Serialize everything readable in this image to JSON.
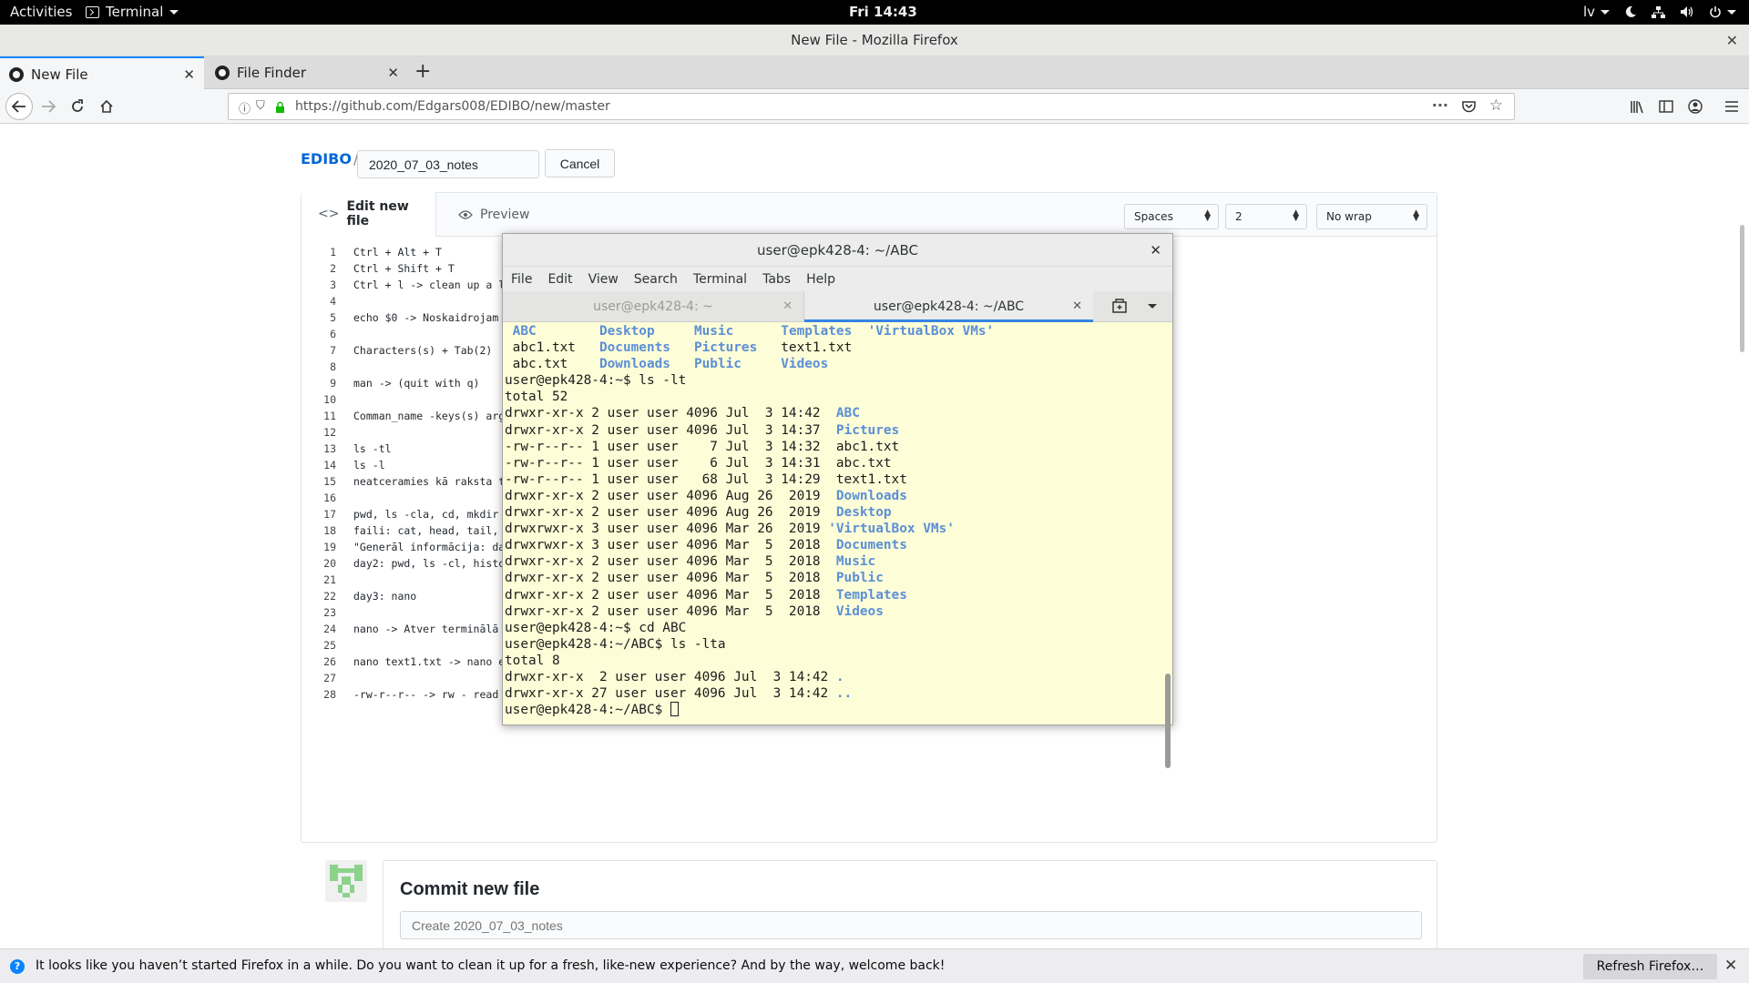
{
  "topbar": {
    "activities": "Activities",
    "app_name": "Terminal",
    "clock": "Fri 14:43",
    "language": "lv"
  },
  "firefox": {
    "window_title": "New File - Mozilla Firefox",
    "tabs": [
      {
        "label": "New File",
        "active": true
      },
      {
        "label": "File Finder",
        "active": false
      }
    ],
    "url_host": "https://github.com",
    "url_path": "/Edgars008/EDIBO/new/master",
    "notification": "It looks like you haven’t started Firefox in a while. Do you want to clean it up for a fresh, like-new experience? And by the way, welcome back!",
    "refresh_label": "Refresh Firefox…"
  },
  "github": {
    "repo": "EDIBO",
    "filename": "2020_07_03_notes",
    "cancel_label": "Cancel",
    "tab_edit": "Edit new file",
    "tab_preview": "Preview",
    "indent_mode": "Spaces",
    "indent_size": "2",
    "wrap_mode": "No wrap",
    "code_lines": [
      "Ctrl + Alt + T",
      "Ctrl + Shift + T",
      "Ctrl + l -> clean up a l",
      "",
      "echo $0 -> Noskaidrojam",
      "",
      "Characters(s) + Tab(2)",
      "",
      "man -> (quit with q)",
      "",
      "Comman_name -keys(s) arg",
      "",
      "ls -tl",
      "ls -l",
      "neatceramies kā raksta t",
      "",
      "pwd, ls -cla, cd, mkdir",
      "faili: cat, head, tail,",
      "\"Generāl informācija: da",
      "day2: pwd, ls -cl, histo",
      "",
      "day3: nano",
      "",
      "nano -> Atver terminālā",
      "",
      "nano text1.txt -> nano e",
      "",
      "-rw-r--r-- -> rw - read"
    ],
    "commit_title": "Commit new file",
    "commit_placeholder": "Create 2020_07_03_notes"
  },
  "terminal": {
    "title": "user@epk428-4: ~/ABC",
    "menu": [
      "File",
      "Edit",
      "View",
      "Search",
      "Terminal",
      "Tabs",
      "Help"
    ],
    "tabs": [
      {
        "label": "user@epk428-4: ~",
        "active": false
      },
      {
        "label": "user@epk428-4: ~/ABC",
        "active": true
      }
    ],
    "lines": [
      [
        {
          "t": " "
        },
        {
          "t": "ABC",
          "d": true
        },
        {
          "t": "        "
        },
        {
          "t": "Desktop",
          "d": true
        },
        {
          "t": "     "
        },
        {
          "t": "Music",
          "d": true
        },
        {
          "t": "      "
        },
        {
          "t": "Templates",
          "d": true
        },
        {
          "t": "  "
        },
        {
          "t": "'VirtualBox VMs'",
          "d": true
        }
      ],
      [
        {
          "t": " abc1.txt   "
        },
        {
          "t": "Documents",
          "d": true
        },
        {
          "t": "   "
        },
        {
          "t": "Pictures",
          "d": true
        },
        {
          "t": "   text1.txt"
        }
      ],
      [
        {
          "t": " abc.txt    "
        },
        {
          "t": "Downloads",
          "d": true
        },
        {
          "t": "   "
        },
        {
          "t": "Public",
          "d": true
        },
        {
          "t": "     "
        },
        {
          "t": "Videos",
          "d": true
        }
      ],
      [
        {
          "t": "user@epk428-4:~$ ls -lt"
        }
      ],
      [
        {
          "t": "total 52"
        }
      ],
      [
        {
          "t": "drwxr-xr-x 2 user user 4096 Jul  3 14:42  "
        },
        {
          "t": "ABC",
          "d": true
        }
      ],
      [
        {
          "t": "drwxr-xr-x 2 user user 4096 Jul  3 14:37  "
        },
        {
          "t": "Pictures",
          "d": true
        }
      ],
      [
        {
          "t": "-rw-r--r-- 1 user user    7 Jul  3 14:32  abc1.txt"
        }
      ],
      [
        {
          "t": "-rw-r--r-- 1 user user    6 Jul  3 14:31  abc.txt"
        }
      ],
      [
        {
          "t": "-rw-r--r-- 1 user user   68 Jul  3 14:29  text1.txt"
        }
      ],
      [
        {
          "t": "drwxr-xr-x 2 user user 4096 Aug 26  2019  "
        },
        {
          "t": "Downloads",
          "d": true
        }
      ],
      [
        {
          "t": "drwxr-xr-x 2 user user 4096 Aug 26  2019  "
        },
        {
          "t": "Desktop",
          "d": true
        }
      ],
      [
        {
          "t": "drwxrwxr-x 3 user user 4096 Mar 26  2019 "
        },
        {
          "t": "'VirtualBox VMs'",
          "d": true
        }
      ],
      [
        {
          "t": "drwxrwxr-x 3 user user 4096 Mar  5  2018  "
        },
        {
          "t": "Documents",
          "d": true
        }
      ],
      [
        {
          "t": "drwxr-xr-x 2 user user 4096 Mar  5  2018  "
        },
        {
          "t": "Music",
          "d": true
        }
      ],
      [
        {
          "t": "drwxr-xr-x 2 user user 4096 Mar  5  2018  "
        },
        {
          "t": "Public",
          "d": true
        }
      ],
      [
        {
          "t": "drwxr-xr-x 2 user user 4096 Mar  5  2018  "
        },
        {
          "t": "Templates",
          "d": true
        }
      ],
      [
        {
          "t": "drwxr-xr-x 2 user user 4096 Mar  5  2018  "
        },
        {
          "t": "Videos",
          "d": true
        }
      ],
      [
        {
          "t": "user@epk428-4:~$ cd ABC"
        }
      ],
      [
        {
          "t": "user@epk428-4:~/ABC$ ls -lta"
        }
      ],
      [
        {
          "t": "total 8"
        }
      ],
      [
        {
          "t": "drwxr-xr-x  2 user user 4096 Jul  3 14:42 "
        },
        {
          "t": ".",
          "d": true
        }
      ],
      [
        {
          "t": "drwxr-xr-x 27 user user 4096 Jul  3 14:42 "
        },
        {
          "t": "..",
          "d": true
        }
      ],
      [
        {
          "t": "user@epk428-4:~/ABC$ "
        },
        {
          "cursor": true
        }
      ]
    ],
    "colors": {
      "background": "#fdfdd8",
      "directory": "#5b8fd6",
      "accent": "#3584e4"
    }
  }
}
